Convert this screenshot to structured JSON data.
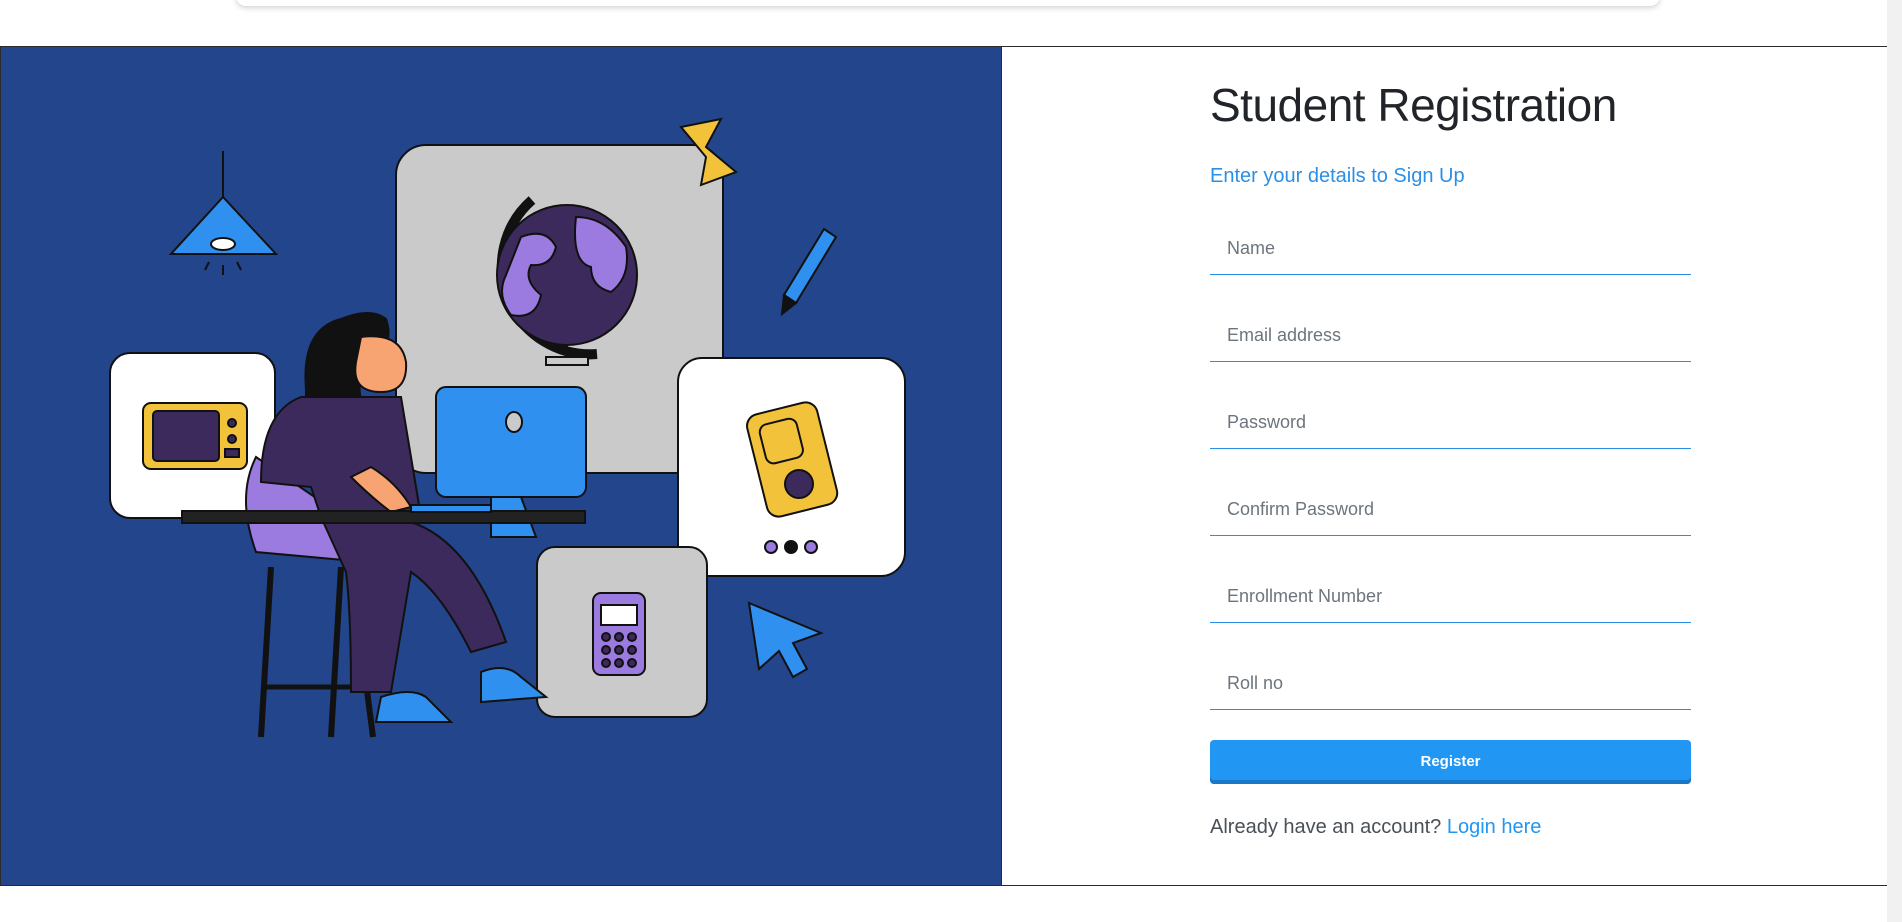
{
  "form": {
    "title": "Student Registration",
    "subtitle": "Enter your details to Sign Up",
    "fields": [
      {
        "placeholder": "Name",
        "value": ""
      },
      {
        "placeholder": "Email address",
        "value": ""
      },
      {
        "placeholder": "Password",
        "value": ""
      },
      {
        "placeholder": "Confirm Password",
        "value": ""
      },
      {
        "placeholder": "Enrollment Number",
        "value": ""
      },
      {
        "placeholder": "Roll no",
        "value": ""
      }
    ],
    "register_label": "Register",
    "footer_prompt": "Already have an account?",
    "login_link": "Login here"
  },
  "colors": {
    "panel_bg": "#22458b",
    "accent": "#2196f3"
  }
}
